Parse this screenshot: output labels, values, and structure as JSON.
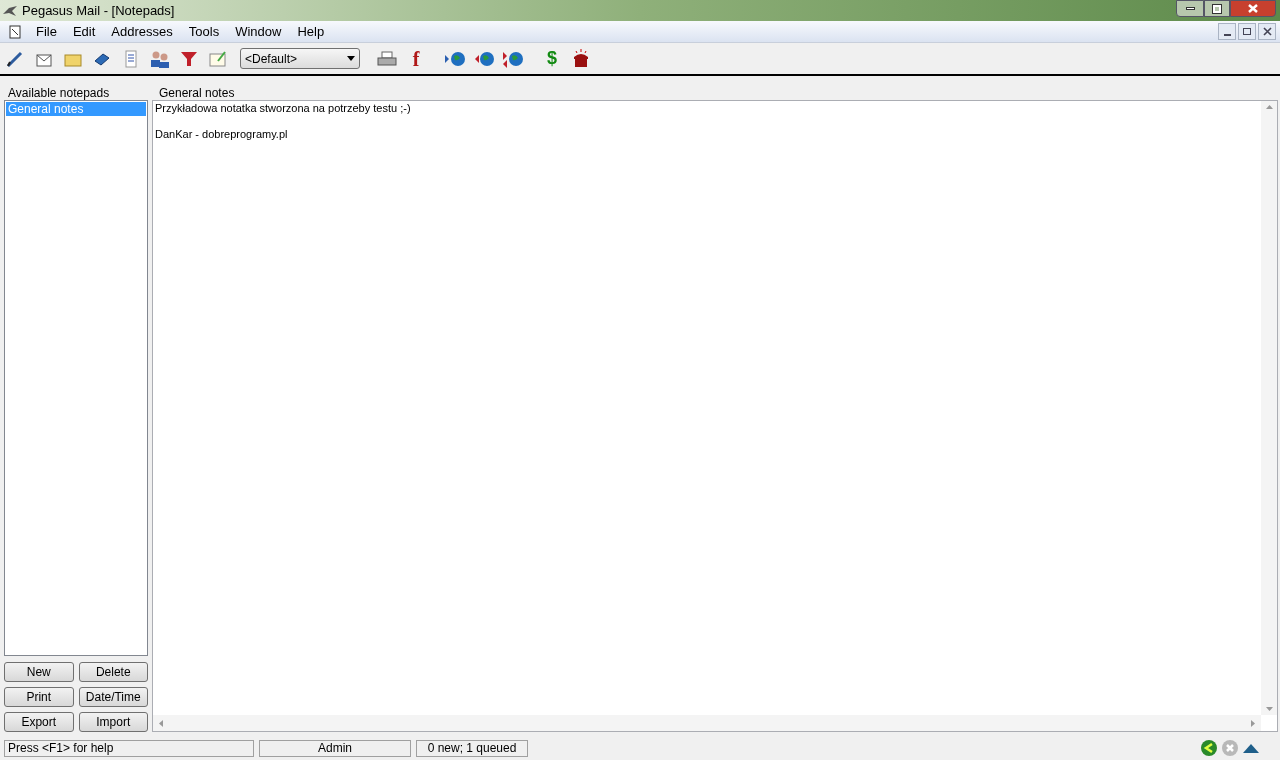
{
  "window": {
    "title": "Pegasus Mail - [Notepads]"
  },
  "menu": [
    "File",
    "Edit",
    "Addresses",
    "Tools",
    "Window",
    "Help"
  ],
  "toolbar": {
    "profile_select": {
      "value": "<Default>"
    },
    "glyph_buttons": [
      {
        "kind": "fax",
        "char": "f"
      },
      {
        "kind": "money",
        "char": "$"
      }
    ]
  },
  "notepads": {
    "label": "Available notepads",
    "items": [
      {
        "name": "General notes",
        "selected": true
      }
    ],
    "buttons": [
      "New",
      "Delete",
      "Print",
      "Date/Time",
      "Export",
      "Import"
    ]
  },
  "editor": {
    "label": "General notes",
    "paragraphs": [
      "Przykładowa notatka stworzona na potrzeby testu ;-)",
      "DanKar - dobreprogramy.pl"
    ]
  },
  "status_bar": [
    "Press <F1> for help",
    "Admin",
    "0 new; 1 queued"
  ]
}
